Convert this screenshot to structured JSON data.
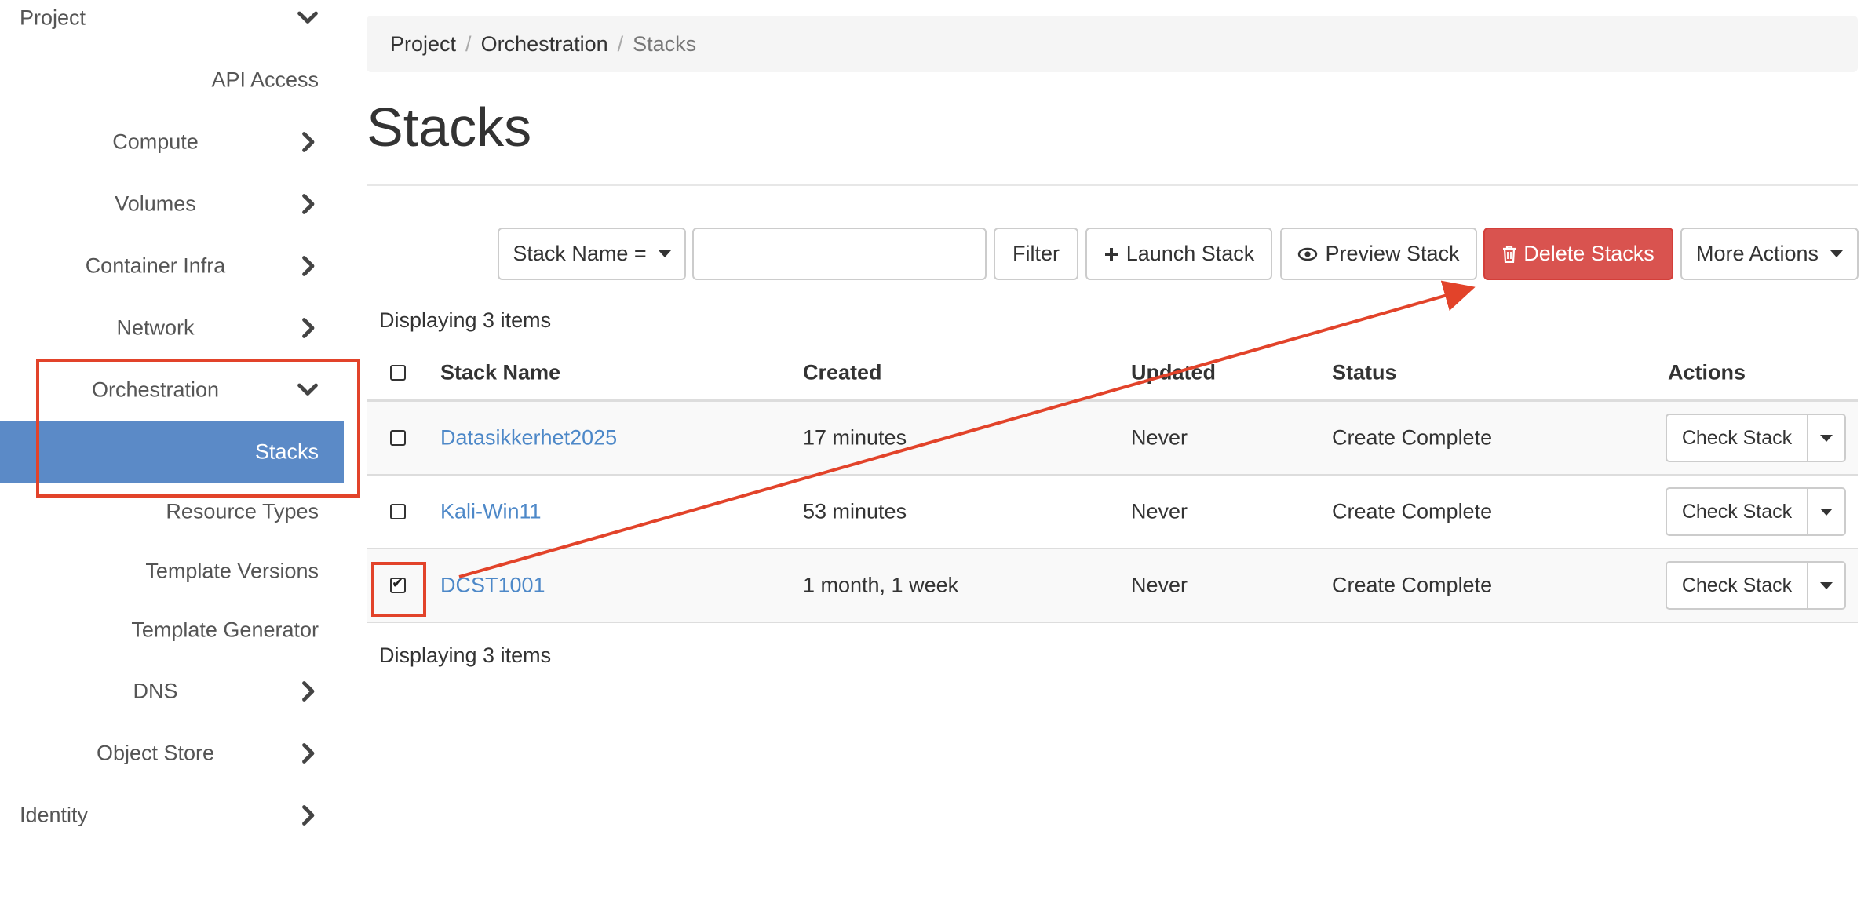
{
  "sidebar": {
    "project": "Project",
    "api_access": "API Access",
    "compute": "Compute",
    "volumes": "Volumes",
    "container_infra": "Container Infra",
    "network": "Network",
    "orchestration": "Orchestration",
    "stacks": "Stacks",
    "resource_types": "Resource Types",
    "template_versions": "Template Versions",
    "template_generator": "Template Generator",
    "dns": "DNS",
    "object_store": "Object Store",
    "identity": "Identity"
  },
  "breadcrumb": [
    "Project",
    "Orchestration",
    "Stacks"
  ],
  "page_title": "Stacks",
  "toolbar": {
    "filter_field": "Stack Name =",
    "filter_value": "",
    "filter_button": "Filter",
    "launch_button": "Launch Stack",
    "preview_button": "Preview Stack",
    "delete_button": "Delete Stacks",
    "more_actions": "More Actions"
  },
  "count_text": "Displaying 3 items",
  "table": {
    "headers": [
      "Stack Name",
      "Created",
      "Updated",
      "Status",
      "Actions"
    ],
    "rows": [
      {
        "name": "Datasikkerhet2025",
        "created": "17 minutes",
        "updated": "Never",
        "status": "Create Complete",
        "action": "Check Stack",
        "checked": false
      },
      {
        "name": "Kali-Win11",
        "created": "53 minutes",
        "updated": "Never",
        "status": "Create Complete",
        "action": "Check Stack",
        "checked": false
      },
      {
        "name": "DCST1001",
        "created": "1 month, 1 week",
        "updated": "Never",
        "status": "Create Complete",
        "action": "Check Stack",
        "checked": true
      }
    ]
  },
  "colors": {
    "active_nav": "#5b8ac7",
    "danger": "#d9534f",
    "link": "#4d88c8",
    "annotation": "#e2432a"
  },
  "icons": [
    "chevron-down-icon",
    "chevron-right-icon",
    "plus-icon",
    "eye-icon",
    "trash-icon",
    "caret-down-icon",
    "check-icon"
  ]
}
